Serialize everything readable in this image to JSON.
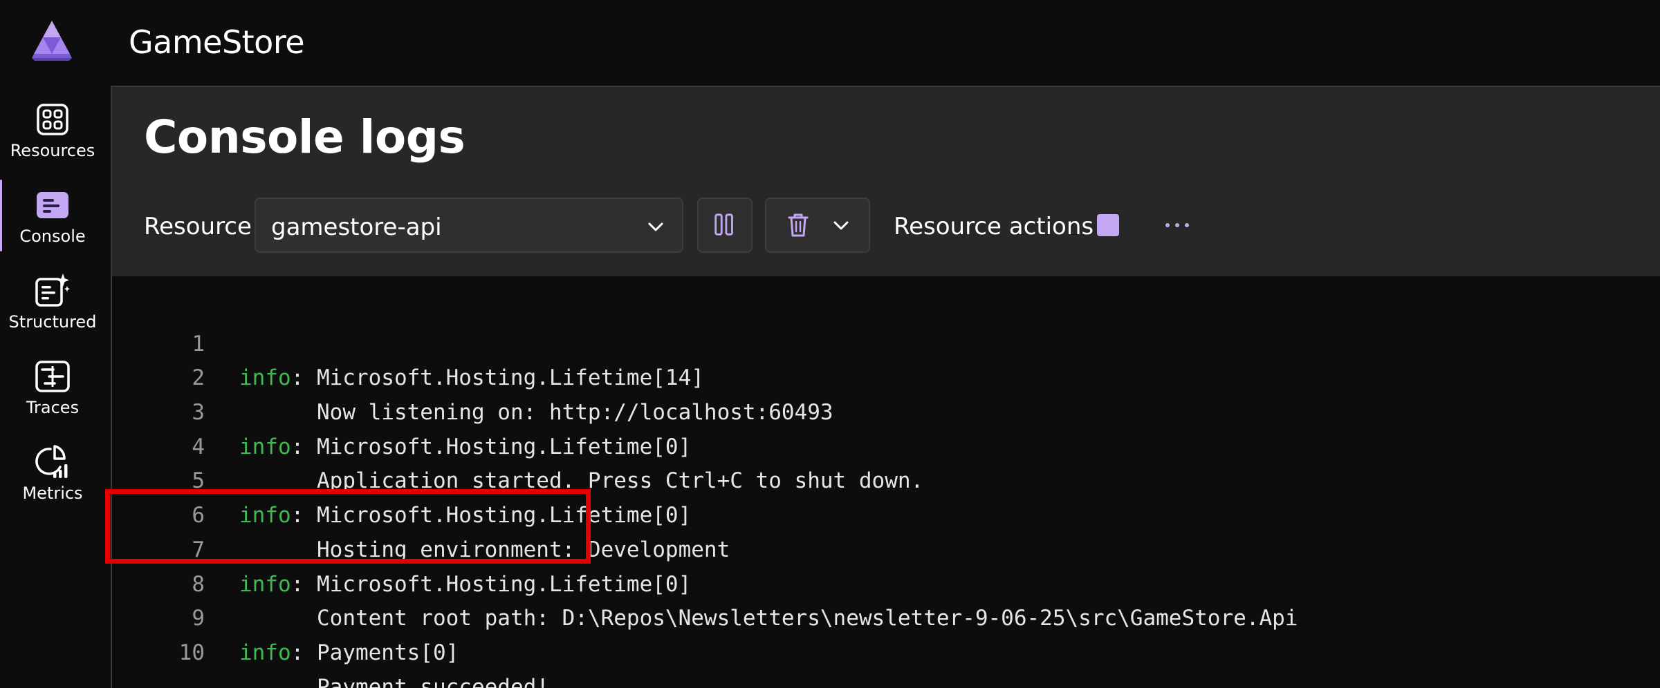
{
  "app": {
    "title": "GameStore"
  },
  "nav": {
    "items": [
      {
        "label": "Resources",
        "icon": "resources-grid-icon",
        "active": false
      },
      {
        "label": "Console",
        "icon": "console-icon",
        "active": true
      },
      {
        "label": "Structured",
        "icon": "structured-logs-icon",
        "active": false
      },
      {
        "label": "Traces",
        "icon": "traces-icon",
        "active": false
      },
      {
        "label": "Metrics",
        "icon": "metrics-icon",
        "active": false
      }
    ]
  },
  "page": {
    "title": "Console logs"
  },
  "toolbar": {
    "resource_label": "Resource",
    "resource_value": "gamestore-api",
    "resource_actions_label": "Resource actions"
  },
  "colors": {
    "accent": "#c4a7f2",
    "info_level": "#3fb950",
    "highlight": "#e50000"
  },
  "logs": [
    {
      "line": "1",
      "level": "info",
      "text": ": Microsoft.Hosting.Lifetime[14]"
    },
    {
      "line": "2",
      "level": "",
      "text": "Now listening on: http://localhost:60493"
    },
    {
      "line": "3",
      "level": "info",
      "text": ": Microsoft.Hosting.Lifetime[0]"
    },
    {
      "line": "4",
      "level": "",
      "text": "Application started. Press Ctrl+C to shut down."
    },
    {
      "line": "5",
      "level": "info",
      "text": ": Microsoft.Hosting.Lifetime[0]"
    },
    {
      "line": "6",
      "level": "",
      "text": "Hosting environment: Development"
    },
    {
      "line": "7",
      "level": "info",
      "text": ": Microsoft.Hosting.Lifetime[0]"
    },
    {
      "line": "8",
      "level": "",
      "text": "Content root path: D:\\Repos\\Newsletters\\newsletter-9-06-25\\src\\GameStore.Api"
    },
    {
      "line": "9",
      "level": "info",
      "text": ": Payments[0]"
    },
    {
      "line": "10",
      "level": "",
      "text": "Payment succeeded!"
    }
  ]
}
